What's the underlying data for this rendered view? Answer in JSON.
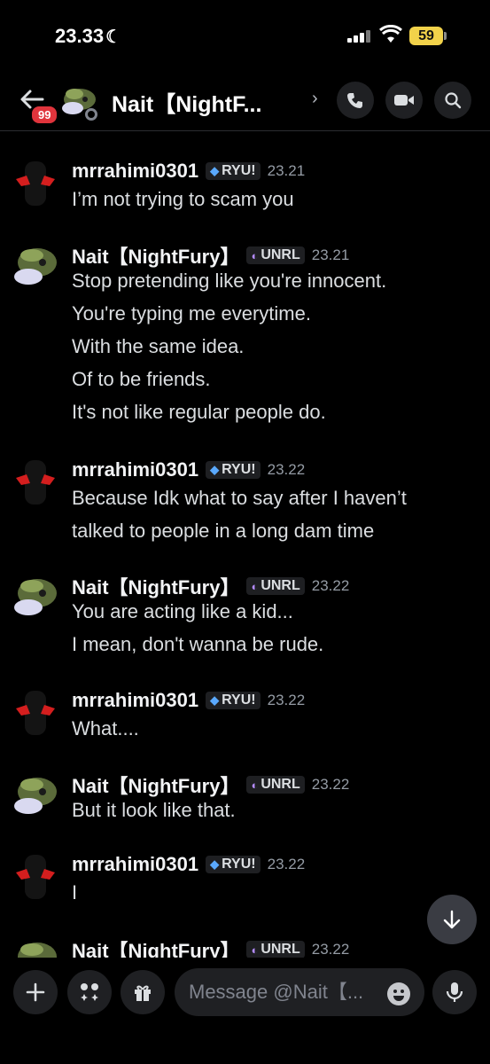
{
  "status_bar": {
    "time": "23.33",
    "battery": "59"
  },
  "header": {
    "title": "Nait【NightF...",
    "unread_badge": "99"
  },
  "composer": {
    "placeholder": "Message @Nait【..."
  },
  "messages": [
    {
      "username": "mrrahimi0301",
      "tag": "RYU!",
      "time": "23.21",
      "lines": [
        "I’m not trying to scam you"
      ]
    },
    {
      "username": "Nait【NightFury】",
      "tag": "UNRL",
      "time": "23.21",
      "lines": [
        "Stop pretending like you're innocent.",
        "You're typing me everytime.",
        "With the same idea.",
        "Of to be friends.",
        "It's not like regular people do."
      ]
    },
    {
      "username": "mrrahimi0301",
      "tag": "RYU!",
      "time": "23.22",
      "lines": [
        "Because Idk what to say after  I haven’t",
        "talked to people in a long dam time"
      ]
    },
    {
      "username": "Nait【NightFury】",
      "tag": "UNRL",
      "time": "23.22",
      "lines": [
        "You are acting like a kid...",
        "I mean, don't wanna be rude."
      ]
    },
    {
      "username": "mrrahimi0301",
      "tag": "RYU!",
      "time": "23.22",
      "lines": [
        "What...."
      ]
    },
    {
      "username": "Nait【NightFury】",
      "tag": "UNRL",
      "time": "23.22",
      "lines": [
        "But it look like that."
      ]
    },
    {
      "username": "mrrahimi0301",
      "tag": "RYU!",
      "time": "23.22",
      "lines": [
        "I"
      ]
    },
    {
      "username": "Nait【NightFury】",
      "tag": "UNRL",
      "time": "23.22",
      "lines": []
    }
  ],
  "colors": {
    "background": "#000000",
    "ryu_icon": "#5aa9ff",
    "unrl_icon": "#b58cff",
    "badge": "#e0343c",
    "battery": "#f2d24a"
  }
}
